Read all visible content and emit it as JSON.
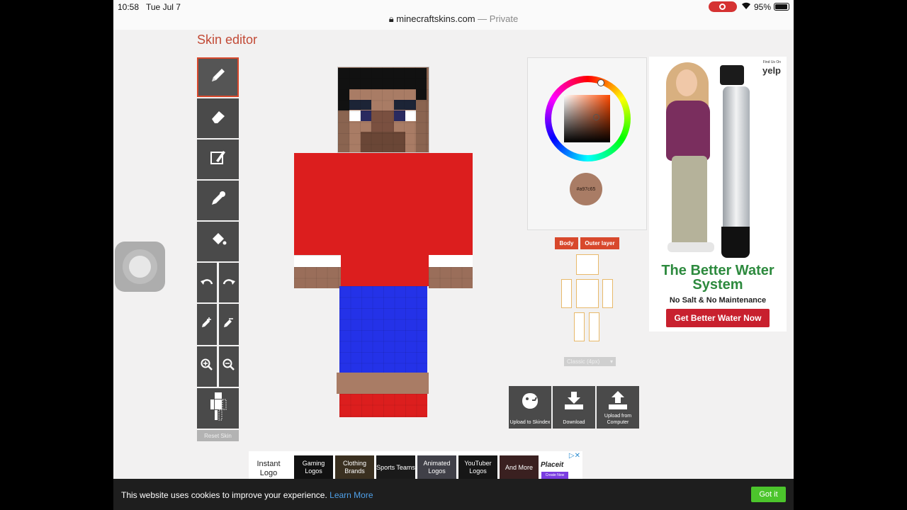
{
  "status_bar": {
    "time": "10:58",
    "date": "Tue Jul 7",
    "url": "minecraftskins.com",
    "url_suffix": "— Private",
    "battery": "95%"
  },
  "page": {
    "title": "Skin editor"
  },
  "tools": {
    "pencil": "pencil-icon",
    "eraser": "eraser-icon",
    "brush": "brush-icon",
    "eyedropper": "eyedropper-icon",
    "bucket": "bucket-icon",
    "undo": "undo-icon",
    "redo": "redo-icon",
    "darken": "darken-icon",
    "lighten": "lighten-icon",
    "zoom_in": "zoom-in-icon",
    "zoom_out": "zoom-out-icon",
    "body_parts": "body-parts-icon",
    "reset_label": "Reset Skin"
  },
  "color_picker": {
    "hex": "#a97c65",
    "swatch_color": "#a97c65"
  },
  "layers": {
    "body_label": "Body",
    "outer_label": "Outer layer"
  },
  "model_select": {
    "value": "Classic (4px)"
  },
  "actions": {
    "upload_skindex": "Upload to Skindex",
    "download": "Download",
    "upload_computer": "Upload from Computer"
  },
  "side_ad": {
    "brand": "yelp",
    "brand_caption": "Find Us On",
    "title": "The Better Water System",
    "subtitle": "No Salt & No Maintenance",
    "cta": "Get Better Water Now"
  },
  "bottom_ad": {
    "first": "Instant Logo",
    "tiles": [
      "Gaming Logos",
      "Clothing Brands",
      "Sports Teams",
      "Animated Logos",
      "YouTuber Logos",
      "And More"
    ],
    "place_brand": "Placeit",
    "place_cta": "Create Now"
  },
  "cookie": {
    "text": "This website uses cookies to improve your experience.",
    "link": "Learn More",
    "button": "Got it"
  },
  "colors": {
    "accent": "#d8482c",
    "shirt": "#dc1e1e",
    "pants": "#2432e8",
    "skin": "#a97c65",
    "hair": "#111111"
  }
}
